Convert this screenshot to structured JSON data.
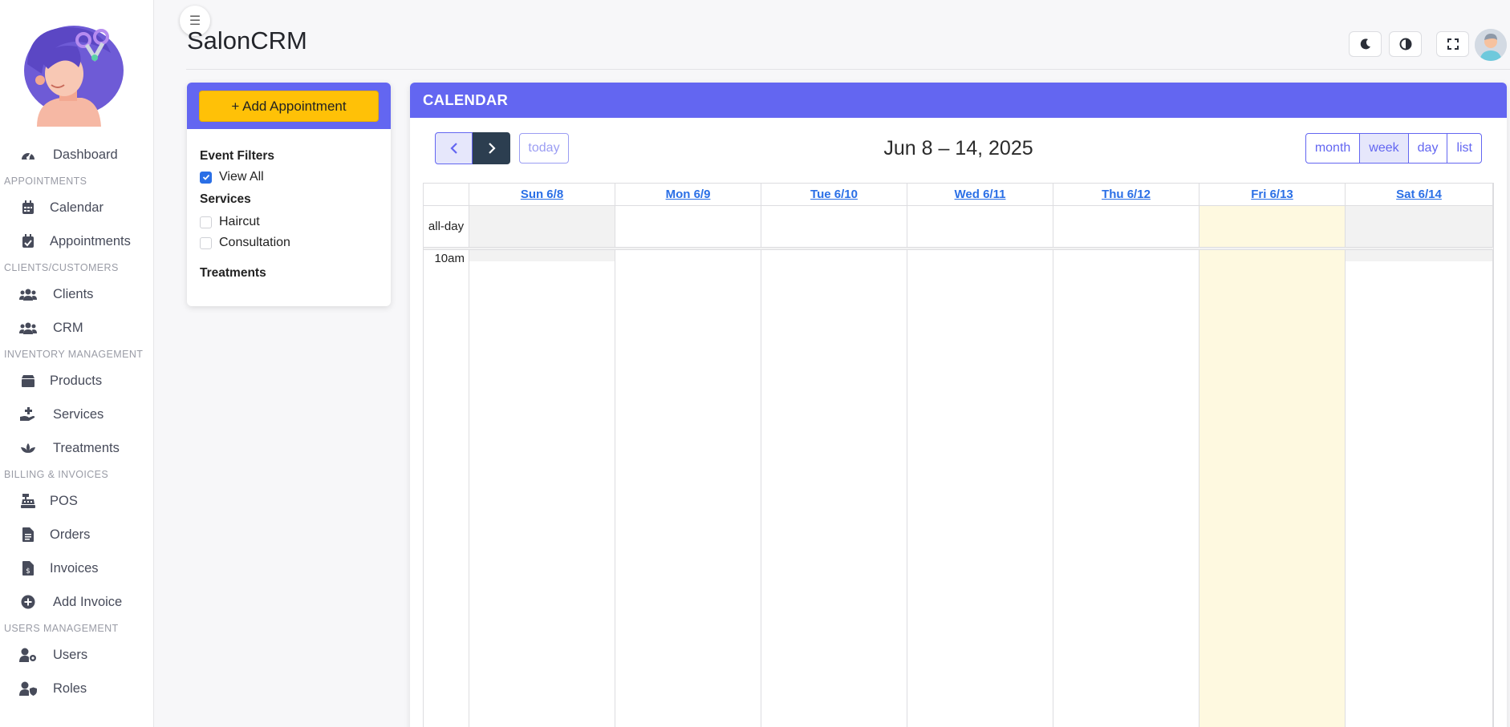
{
  "app": {
    "title": "SalonCRM"
  },
  "colors": {
    "accent": "#6366f1",
    "add_button": "#ffc107",
    "today_highlight": "#fef9e0",
    "weekend": "#f2f2f2"
  },
  "sidebar": {
    "groups": [
      {
        "section": "",
        "items": [
          {
            "label": "Dashboard",
            "icon": "gauge-icon"
          }
        ]
      },
      {
        "section": "APPOINTMENTS",
        "items": [
          {
            "label": "Calendar",
            "icon": "calendar-icon"
          },
          {
            "label": "Appointments",
            "icon": "calendar-check-icon"
          }
        ]
      },
      {
        "section": "CLIENTS/CUSTOMERS",
        "items": [
          {
            "label": "Clients",
            "icon": "users-icon"
          },
          {
            "label": "CRM",
            "icon": "users-icon"
          }
        ]
      },
      {
        "section": "INVENTORY MANAGEMENT",
        "items": [
          {
            "label": "Products",
            "icon": "box-icon"
          },
          {
            "label": "Services",
            "icon": "hand-holding-icon"
          },
          {
            "label": "Treatments",
            "icon": "spa-icon"
          }
        ]
      },
      {
        "section": "BILLING & INVOICES",
        "items": [
          {
            "label": "POS",
            "icon": "cash-register-icon"
          },
          {
            "label": "Orders",
            "icon": "file-icon"
          },
          {
            "label": "Invoices",
            "icon": "file-invoice-icon"
          },
          {
            "label": "Add Invoice",
            "icon": "plus-circle-icon"
          }
        ]
      },
      {
        "section": "USERS MANAGEMENT",
        "items": [
          {
            "label": "Users",
            "icon": "user-gear-icon"
          },
          {
            "label": "Roles",
            "icon": "user-shield-icon"
          }
        ]
      }
    ]
  },
  "header": {
    "buttons": [
      {
        "icon": "moon-icon"
      },
      {
        "icon": "contrast-icon"
      },
      {
        "icon": "fullscreen-icon"
      }
    ],
    "menu_icon": "☰"
  },
  "filters": {
    "add_button": "+ Add Appointment",
    "event_filters_heading": "Event Filters",
    "view_all": "View All",
    "services_heading": "Services",
    "services": [
      {
        "label": "Haircut",
        "checked": false
      },
      {
        "label": "Consultation",
        "checked": false
      }
    ],
    "treatments_heading": "Treatments"
  },
  "calendar": {
    "header": "CALENDAR",
    "range_title": "Jun 8 – 14, 2025",
    "today_label": "today",
    "views": [
      {
        "label": "month",
        "active": false
      },
      {
        "label": "week",
        "active": true
      },
      {
        "label": "day",
        "active": false
      },
      {
        "label": "list",
        "active": false
      }
    ],
    "all_day_label": "all-day",
    "time_label": "10am",
    "days": [
      {
        "label": "Sun 6/8",
        "type": "weekend"
      },
      {
        "label": "Mon 6/9",
        "type": "normal"
      },
      {
        "label": "Tue 6/10",
        "type": "normal"
      },
      {
        "label": "Wed 6/11",
        "type": "normal"
      },
      {
        "label": "Thu 6/12",
        "type": "normal"
      },
      {
        "label": "Fri 6/13",
        "type": "today"
      },
      {
        "label": "Sat 6/14",
        "type": "weekend"
      }
    ]
  }
}
